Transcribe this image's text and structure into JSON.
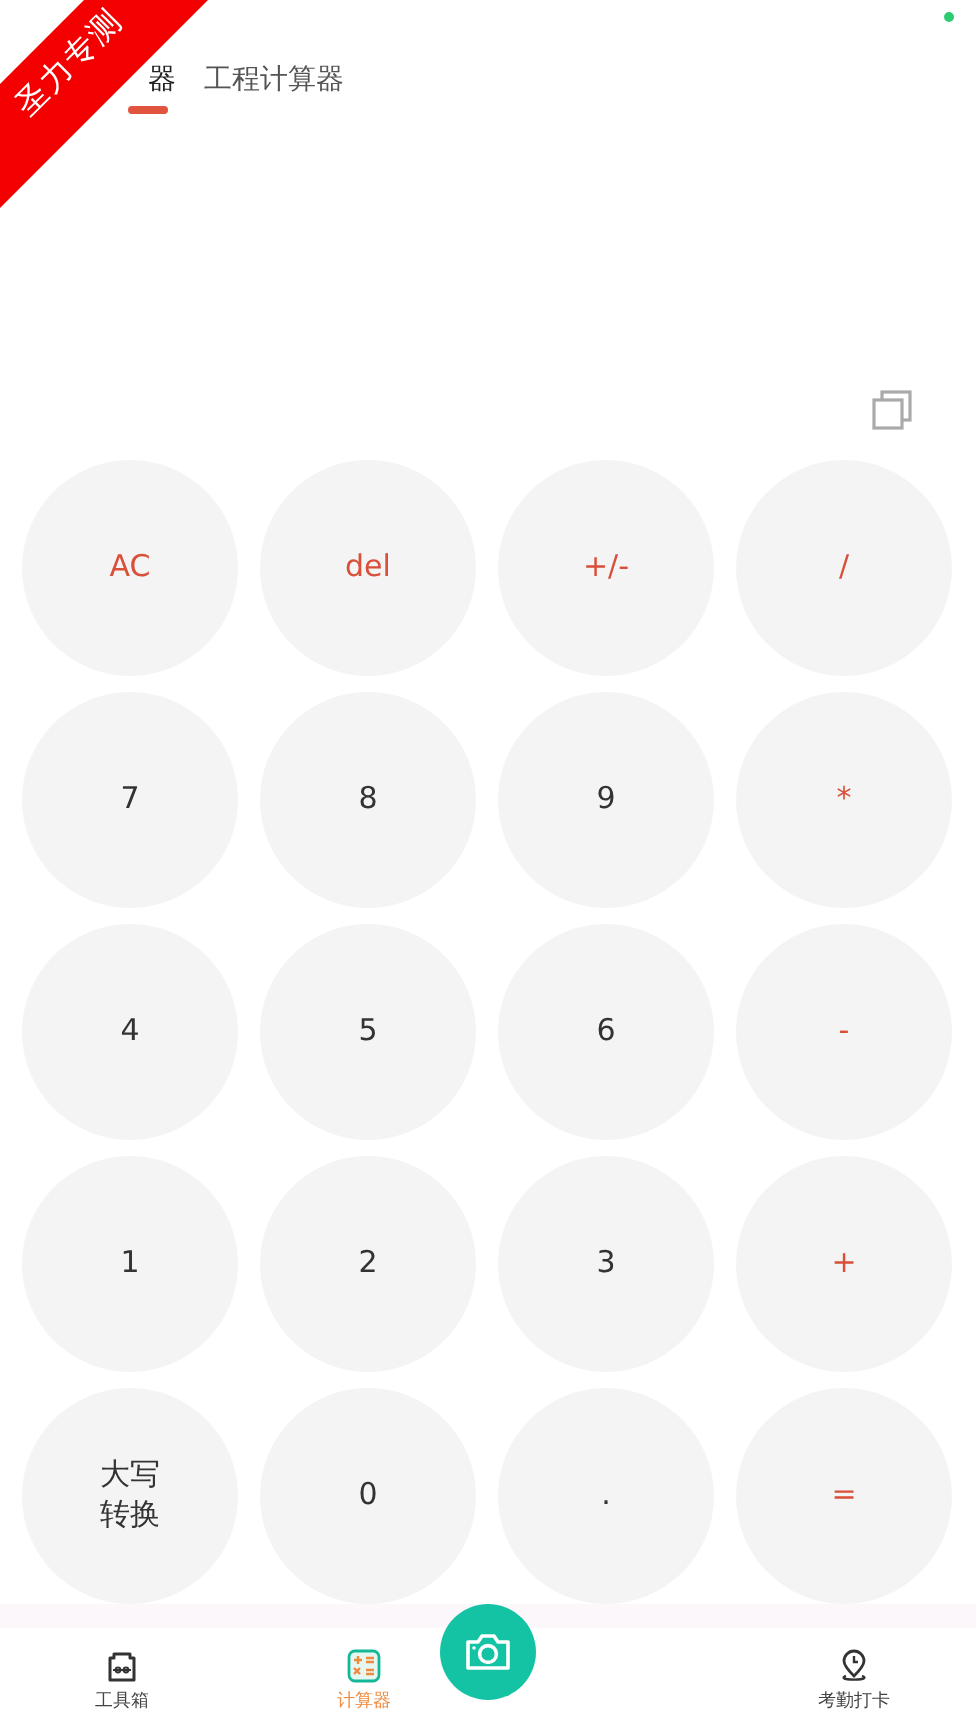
{
  "ribbon": {
    "text": "圣力专测"
  },
  "tabs": [
    {
      "label": "器",
      "selected": true
    },
    {
      "label": "工程计算器",
      "selected": false
    }
  ],
  "keys": [
    {
      "label": "AC",
      "kind": "operator"
    },
    {
      "label": "del",
      "kind": "operator"
    },
    {
      "label": "+/-",
      "kind": "operator"
    },
    {
      "label": "/",
      "kind": "operator"
    },
    {
      "label": "7",
      "kind": "digit"
    },
    {
      "label": "8",
      "kind": "digit"
    },
    {
      "label": "9",
      "kind": "digit"
    },
    {
      "label": "*",
      "kind": "operator"
    },
    {
      "label": "4",
      "kind": "digit"
    },
    {
      "label": "5",
      "kind": "digit"
    },
    {
      "label": "6",
      "kind": "digit"
    },
    {
      "label": "-",
      "kind": "operator"
    },
    {
      "label": "1",
      "kind": "digit"
    },
    {
      "label": "2",
      "kind": "digit"
    },
    {
      "label": "3",
      "kind": "digit"
    },
    {
      "label": "+",
      "kind": "operator"
    },
    {
      "label": "大写转换",
      "kind": "digit"
    },
    {
      "label": "0",
      "kind": "digit"
    },
    {
      "label": ".",
      "kind": "digit"
    },
    {
      "label": "=",
      "kind": "operator"
    }
  ],
  "nav": [
    {
      "label": "工具箱",
      "kind": "toolbox",
      "selected": false
    },
    {
      "label": "计算器",
      "kind": "calculator",
      "selected": true
    },
    {
      "kind": "camera"
    },
    {
      "label": "考勤打卡",
      "kind": "location",
      "selected": false
    }
  ]
}
